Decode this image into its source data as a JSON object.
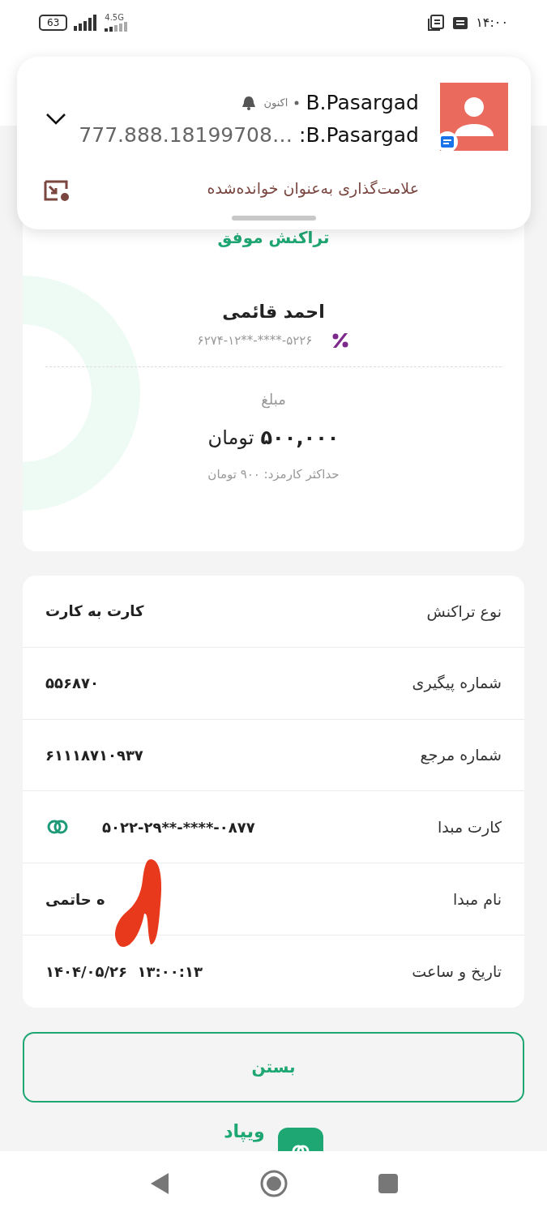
{
  "status_bar": {
    "battery": "63",
    "network": "4.5G",
    "time": "۱۴:۰۰"
  },
  "notification": {
    "app": "B.Pasargad",
    "time": "اکنون",
    "sender": "B.Pasargad:",
    "preview": "…777.888.18199708",
    "action": "علامت‌گذاری به‌عنوان خوانده‌شده",
    "expanded": false
  },
  "receipt": {
    "status": "تراکنش موفق",
    "name": "احمد قائمی",
    "card": "۶۲۷۴-۱۲**-****-۵۲۲۶",
    "amount_label": "مبلغ",
    "amount": "۵۰۰,۰۰۰",
    "currency": "تومان",
    "fee": "حداکثر کارمزد: ۹۰۰ تومان"
  },
  "details": [
    {
      "label": "نوع تراکنش",
      "value": "کارت به کارت",
      "kind": "text"
    },
    {
      "label": "شماره پیگیری",
      "value": "۵۵۶۸۷۰",
      "kind": "text"
    },
    {
      "label": "شماره مرجع",
      "value": "۶۱۱۱۸۷۱۰۹۳۷",
      "kind": "text"
    },
    {
      "label": "کارت مبدا",
      "value": "۵۰۲۲-۲۹**-****-۰۸۷۷",
      "kind": "card"
    },
    {
      "label": "نام مبدا",
      "value": "ه حاتمی",
      "kind": "scribbled"
    },
    {
      "label": "تاریخ و ساعت",
      "value": "۱۴۰۴/۰۵/۲۶  ۱۳:۰۰:۱۳",
      "kind": "text"
    }
  ],
  "close_button": "بستن",
  "brand": "ویپاد"
}
